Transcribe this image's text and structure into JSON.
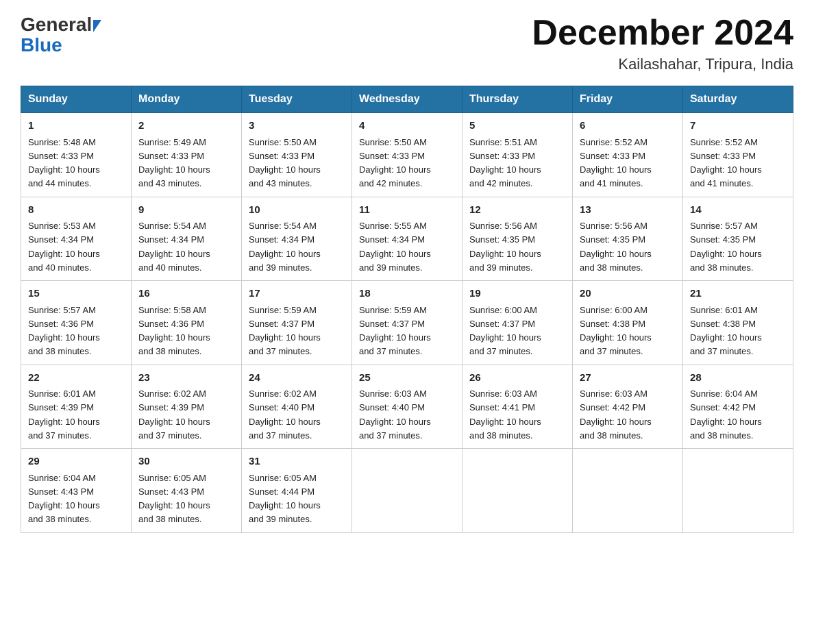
{
  "header": {
    "logo_general": "General",
    "logo_blue": "Blue",
    "title": "December 2024",
    "subtitle": "Kailashahar, Tripura, India"
  },
  "days_of_week": [
    "Sunday",
    "Monday",
    "Tuesday",
    "Wednesday",
    "Thursday",
    "Friday",
    "Saturday"
  ],
  "weeks": [
    [
      {
        "day": "1",
        "sunrise": "5:48 AM",
        "sunset": "4:33 PM",
        "daylight": "10 hours and 44 minutes."
      },
      {
        "day": "2",
        "sunrise": "5:49 AM",
        "sunset": "4:33 PM",
        "daylight": "10 hours and 43 minutes."
      },
      {
        "day": "3",
        "sunrise": "5:50 AM",
        "sunset": "4:33 PM",
        "daylight": "10 hours and 43 minutes."
      },
      {
        "day": "4",
        "sunrise": "5:50 AM",
        "sunset": "4:33 PM",
        "daylight": "10 hours and 42 minutes."
      },
      {
        "day": "5",
        "sunrise": "5:51 AM",
        "sunset": "4:33 PM",
        "daylight": "10 hours and 42 minutes."
      },
      {
        "day": "6",
        "sunrise": "5:52 AM",
        "sunset": "4:33 PM",
        "daylight": "10 hours and 41 minutes."
      },
      {
        "day": "7",
        "sunrise": "5:52 AM",
        "sunset": "4:33 PM",
        "daylight": "10 hours and 41 minutes."
      }
    ],
    [
      {
        "day": "8",
        "sunrise": "5:53 AM",
        "sunset": "4:34 PM",
        "daylight": "10 hours and 40 minutes."
      },
      {
        "day": "9",
        "sunrise": "5:54 AM",
        "sunset": "4:34 PM",
        "daylight": "10 hours and 40 minutes."
      },
      {
        "day": "10",
        "sunrise": "5:54 AM",
        "sunset": "4:34 PM",
        "daylight": "10 hours and 39 minutes."
      },
      {
        "day": "11",
        "sunrise": "5:55 AM",
        "sunset": "4:34 PM",
        "daylight": "10 hours and 39 minutes."
      },
      {
        "day": "12",
        "sunrise": "5:56 AM",
        "sunset": "4:35 PM",
        "daylight": "10 hours and 39 minutes."
      },
      {
        "day": "13",
        "sunrise": "5:56 AM",
        "sunset": "4:35 PM",
        "daylight": "10 hours and 38 minutes."
      },
      {
        "day": "14",
        "sunrise": "5:57 AM",
        "sunset": "4:35 PM",
        "daylight": "10 hours and 38 minutes."
      }
    ],
    [
      {
        "day": "15",
        "sunrise": "5:57 AM",
        "sunset": "4:36 PM",
        "daylight": "10 hours and 38 minutes."
      },
      {
        "day": "16",
        "sunrise": "5:58 AM",
        "sunset": "4:36 PM",
        "daylight": "10 hours and 38 minutes."
      },
      {
        "day": "17",
        "sunrise": "5:59 AM",
        "sunset": "4:37 PM",
        "daylight": "10 hours and 37 minutes."
      },
      {
        "day": "18",
        "sunrise": "5:59 AM",
        "sunset": "4:37 PM",
        "daylight": "10 hours and 37 minutes."
      },
      {
        "day": "19",
        "sunrise": "6:00 AM",
        "sunset": "4:37 PM",
        "daylight": "10 hours and 37 minutes."
      },
      {
        "day": "20",
        "sunrise": "6:00 AM",
        "sunset": "4:38 PM",
        "daylight": "10 hours and 37 minutes."
      },
      {
        "day": "21",
        "sunrise": "6:01 AM",
        "sunset": "4:38 PM",
        "daylight": "10 hours and 37 minutes."
      }
    ],
    [
      {
        "day": "22",
        "sunrise": "6:01 AM",
        "sunset": "4:39 PM",
        "daylight": "10 hours and 37 minutes."
      },
      {
        "day": "23",
        "sunrise": "6:02 AM",
        "sunset": "4:39 PM",
        "daylight": "10 hours and 37 minutes."
      },
      {
        "day": "24",
        "sunrise": "6:02 AM",
        "sunset": "4:40 PM",
        "daylight": "10 hours and 37 minutes."
      },
      {
        "day": "25",
        "sunrise": "6:03 AM",
        "sunset": "4:40 PM",
        "daylight": "10 hours and 37 minutes."
      },
      {
        "day": "26",
        "sunrise": "6:03 AM",
        "sunset": "4:41 PM",
        "daylight": "10 hours and 38 minutes."
      },
      {
        "day": "27",
        "sunrise": "6:03 AM",
        "sunset": "4:42 PM",
        "daylight": "10 hours and 38 minutes."
      },
      {
        "day": "28",
        "sunrise": "6:04 AM",
        "sunset": "4:42 PM",
        "daylight": "10 hours and 38 minutes."
      }
    ],
    [
      {
        "day": "29",
        "sunrise": "6:04 AM",
        "sunset": "4:43 PM",
        "daylight": "10 hours and 38 minutes."
      },
      {
        "day": "30",
        "sunrise": "6:05 AM",
        "sunset": "4:43 PM",
        "daylight": "10 hours and 38 minutes."
      },
      {
        "day": "31",
        "sunrise": "6:05 AM",
        "sunset": "4:44 PM",
        "daylight": "10 hours and 39 minutes."
      },
      null,
      null,
      null,
      null
    ]
  ],
  "labels": {
    "sunrise": "Sunrise:",
    "sunset": "Sunset:",
    "daylight": "Daylight:"
  }
}
